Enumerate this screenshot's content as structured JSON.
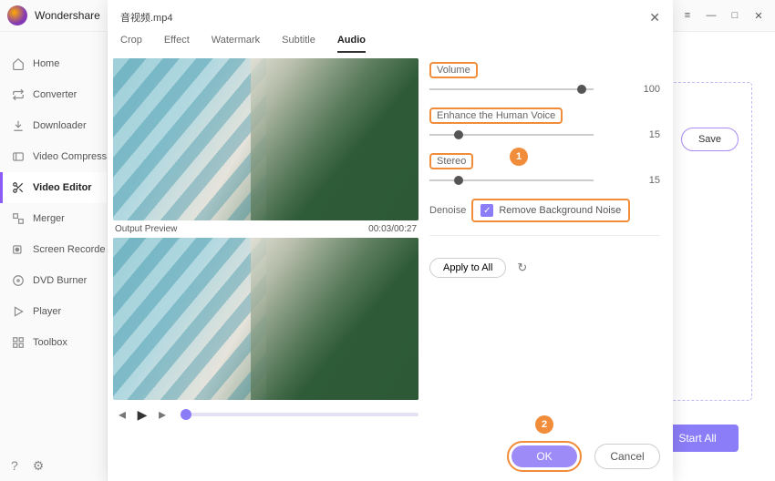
{
  "brand": "Wondershare",
  "sidebar": {
    "items": [
      {
        "label": "Home",
        "icon": "home"
      },
      {
        "label": "Converter",
        "icon": "convert"
      },
      {
        "label": "Downloader",
        "icon": "download"
      },
      {
        "label": "Video Compress",
        "icon": "compress"
      },
      {
        "label": "Video Editor",
        "icon": "scissors"
      },
      {
        "label": "Merger",
        "icon": "merge"
      },
      {
        "label": "Screen Recorde",
        "icon": "record"
      },
      {
        "label": "DVD Burner",
        "icon": "dvd"
      },
      {
        "label": "Player",
        "icon": "play"
      },
      {
        "label": "Toolbox",
        "icon": "grid"
      }
    ]
  },
  "main": {
    "save_label": "Save",
    "start_all_label": "Start All"
  },
  "dialog": {
    "title": "音视频.mp4",
    "tabs": [
      "Crop",
      "Effect",
      "Watermark",
      "Subtitle",
      "Audio"
    ],
    "active_tab": 4,
    "output_preview_label": "Output Preview",
    "timecode": "00:03/00:27",
    "audio": {
      "volume": {
        "label": "Volume",
        "value": 100,
        "pos": 90
      },
      "enhance": {
        "label": "Enhance the Human Voice",
        "value": 15,
        "pos": 15
      },
      "stereo": {
        "label": "Stereo",
        "value": 15,
        "pos": 15
      },
      "denoise_label": "Denoise",
      "remove_noise_label": "Remove Background Noise",
      "remove_noise_checked": true
    },
    "apply_all_label": "Apply to All",
    "ok_label": "OK",
    "cancel_label": "Cancel",
    "badge1": "1",
    "badge2": "2"
  }
}
